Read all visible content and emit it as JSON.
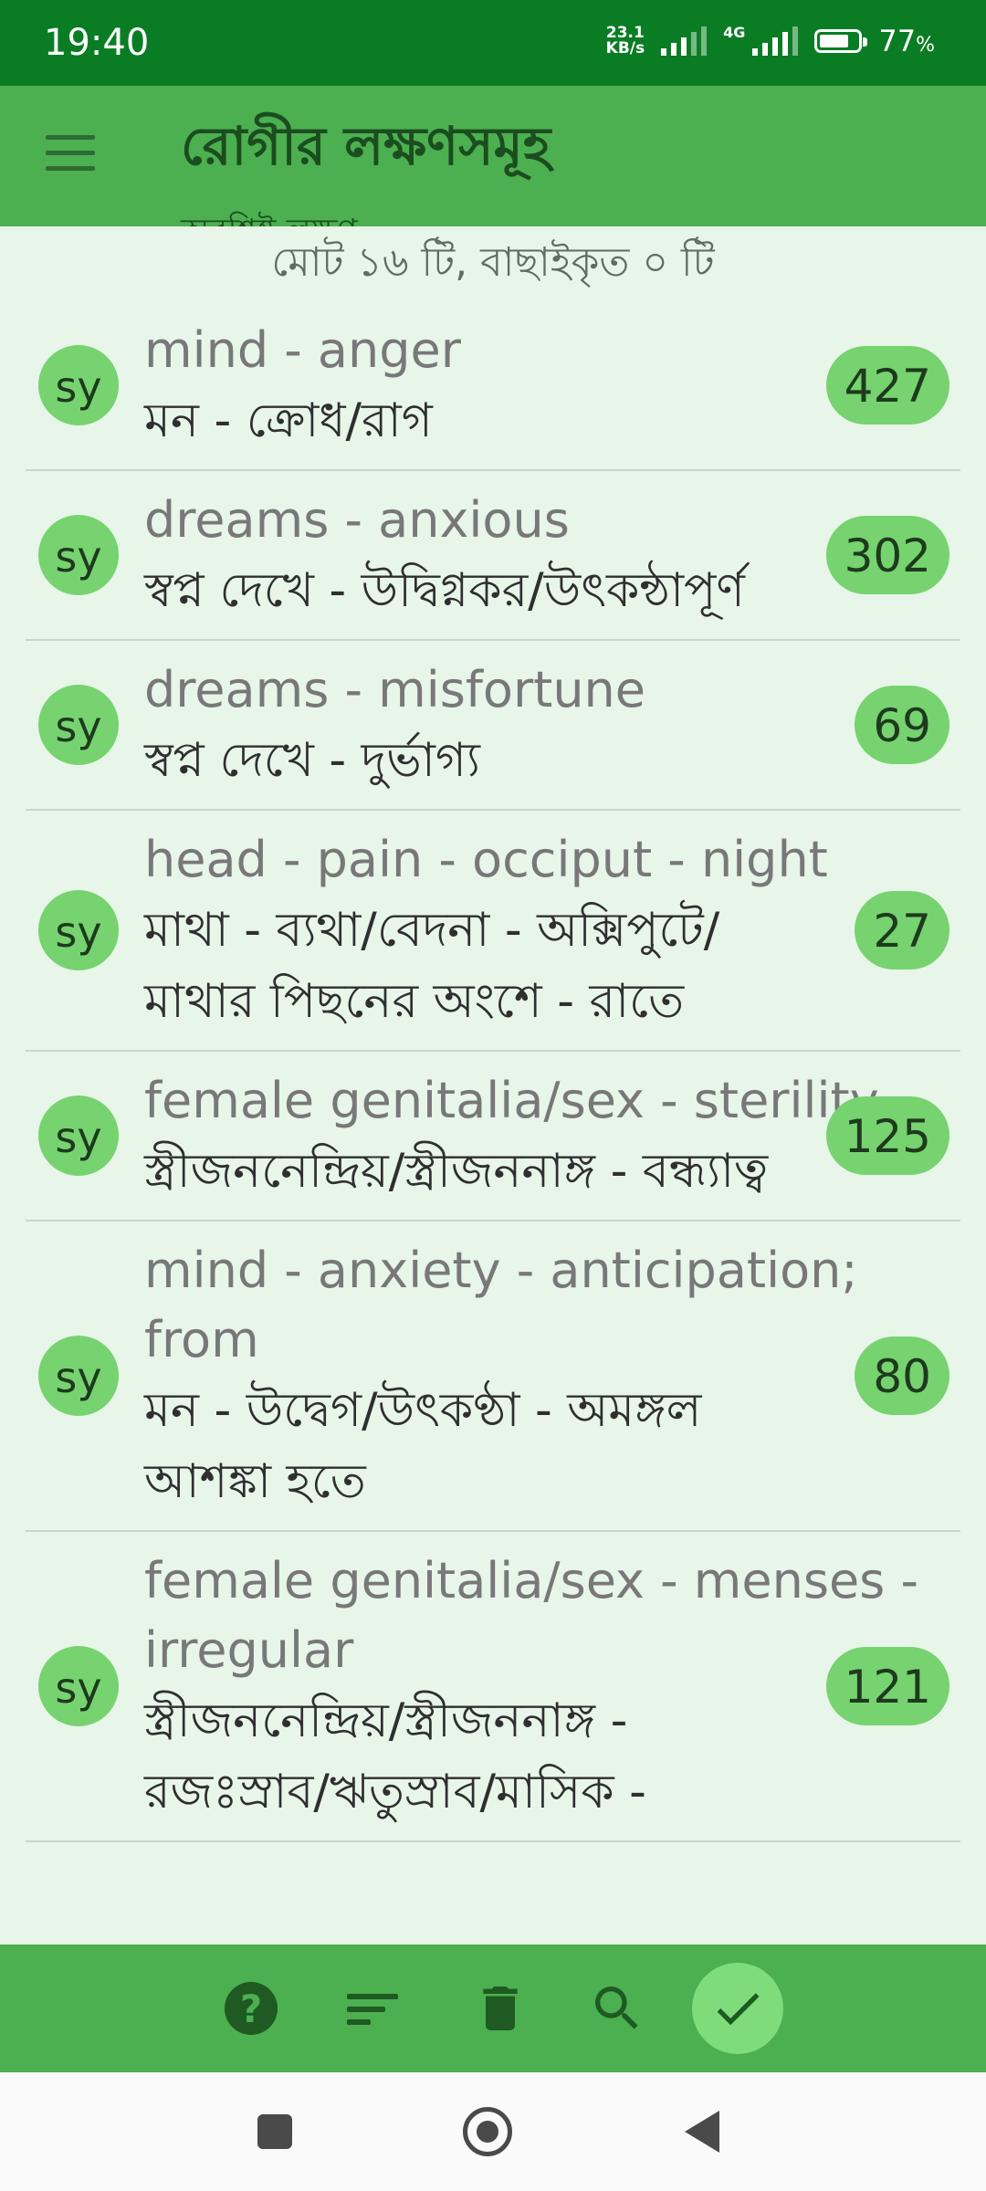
{
  "status_bar": {
    "time": "19:40",
    "net_speed_value": "23.1",
    "net_speed_unit": "KB/s",
    "network_type": "4G",
    "battery_level": 0.77,
    "battery_text": "77",
    "battery_unit": "%"
  },
  "app_bar": {
    "title": "রোগীর লক্ষণসমূহ",
    "subtitle": "অবশিষ্ট লক্ষণ",
    "menu_icon": "menu-icon"
  },
  "summary": "মোট ১৬ টি, বাছাইকৃত ০ টি",
  "symptoms": [
    {
      "badge": "sy",
      "english": "mind - anger",
      "bengali": "মন - ক্রোধ/রাগ",
      "count": "427"
    },
    {
      "badge": "sy",
      "english": "dreams - anxious",
      "bengali": "স্বপ্ন দেখে - উদ্বিগ্নকর/উৎকন্ঠাপূর্ণ",
      "count": "302"
    },
    {
      "badge": "sy",
      "english": "dreams - misfortune",
      "bengali": "স্বপ্ন দেখে - দুর্ভাগ্য",
      "count": "69"
    },
    {
      "badge": "sy",
      "english": "head - pain - occiput - night",
      "bengali": "মাথা - ব্যথা/বেদনা - অক্সিপুটে/ মাথার পিছনের অংশে - রাতে",
      "count": "27"
    },
    {
      "badge": "sy",
      "english": "female genitalia/sex - sterility",
      "bengali": "স্ত্রীজননেন্দ্রিয়/স্ত্রীজননাঙ্গ - বন্ধ্যাত্ব",
      "count": "125"
    },
    {
      "badge": "sy",
      "english": "mind - anxiety - anticipation; from",
      "bengali": "মন - উদ্বেগ/উৎকণ্ঠা - অমঙ্গল আশঙ্কা হতে",
      "count": "80"
    },
    {
      "badge": "sy",
      "english": "female genitalia/sex - menses - irregular",
      "bengali": "স্ত্রীজননেন্দ্রিয়/স্ত্রীজননাঙ্গ - রজঃস্রাব/ঋতুস্রাব/মাসিক -",
      "count": "121"
    }
  ],
  "toolbar": {
    "help_glyph": "?",
    "icons": [
      "help-icon",
      "sort-icon",
      "delete-icon",
      "search-icon",
      "check-icon"
    ]
  },
  "nav_bar": {
    "icons": [
      "recents-icon",
      "home-icon",
      "back-icon"
    ]
  },
  "colors": {
    "status_bar": "#0a7d24",
    "app_bar": "#4caf50",
    "background": "#e8f5e9",
    "badge": "#76d36f"
  }
}
